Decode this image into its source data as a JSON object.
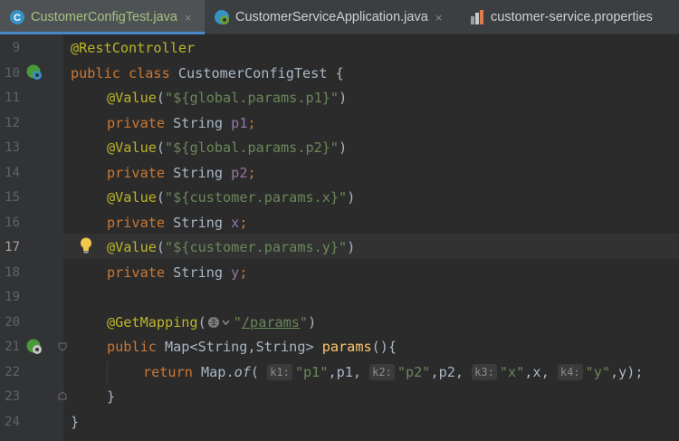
{
  "tabs": [
    {
      "label": "CustomerConfigTest.java",
      "active": true,
      "icon": "class-icon"
    },
    {
      "label": "CustomerServiceApplication.java",
      "active": false,
      "icon": "spring-boot-icon"
    },
    {
      "label": "customer-service.properties",
      "active": false,
      "icon": "properties-icon"
    }
  ],
  "close_glyph": "×",
  "editor": {
    "current_line": "17",
    "lines": [
      {
        "num": "9"
      },
      {
        "num": "10"
      },
      {
        "num": "11"
      },
      {
        "num": "12"
      },
      {
        "num": "13"
      },
      {
        "num": "14"
      },
      {
        "num": "15"
      },
      {
        "num": "16"
      },
      {
        "num": "17"
      },
      {
        "num": "18"
      },
      {
        "num": "19"
      },
      {
        "num": "20"
      },
      {
        "num": "21"
      },
      {
        "num": "22"
      },
      {
        "num": "23"
      },
      {
        "num": "24"
      }
    ],
    "tokens": {
      "l9": "@RestController",
      "l10a": "public class ",
      "l10b": "CustomerConfigTest {",
      "l11a": "@Value",
      "l11b": "(",
      "l11c": "\"${global.params.p1}\"",
      "l11d": ")",
      "l12a": "private ",
      "l12b": "String ",
      "l12c": "p1",
      "l12d": ";",
      "l13a": "@Value",
      "l13b": "(",
      "l13c": "\"${global.params.p2}\"",
      "l13d": ")",
      "l14a": "private ",
      "l14b": "String ",
      "l14c": "p2",
      "l14d": ";",
      "l15a": "@Value",
      "l15b": "(",
      "l15c": "\"${customer.params.x}\"",
      "l15d": ")",
      "l16a": "private ",
      "l16b": "String ",
      "l16c": "x",
      "l16d": ";",
      "l17a": "@Value",
      "l17b": "(",
      "l17c": "\"${customer.params.y}\"",
      "l17d": ")",
      "l18a": "private ",
      "l18b": "String ",
      "l18c": "y",
      "l18d": ";",
      "l20a": "@GetMapping",
      "l20b": "(",
      "l20c": "\"",
      "l20d": "/params",
      "l20e": "\"",
      "l20f": ")",
      "l21a": "public ",
      "l21b": "Map<String,String> ",
      "l21c": "params",
      "l21d": "(){",
      "l22a": "return ",
      "l22b": "Map.",
      "l22c": "of",
      "l22d": "( ",
      "h1": "k1:",
      "s1": "\"p1\"",
      "v1": ",p1, ",
      "h2": "k2:",
      "s2": "\"p2\"",
      "v2": ",p2, ",
      "h3": "k3:",
      "s3": "\"x\"",
      "v3": ",x, ",
      "h4": "k4:",
      "s4": "\"y\"",
      "v4": ",y);",
      "l23": "}",
      "l24": "}"
    }
  }
}
